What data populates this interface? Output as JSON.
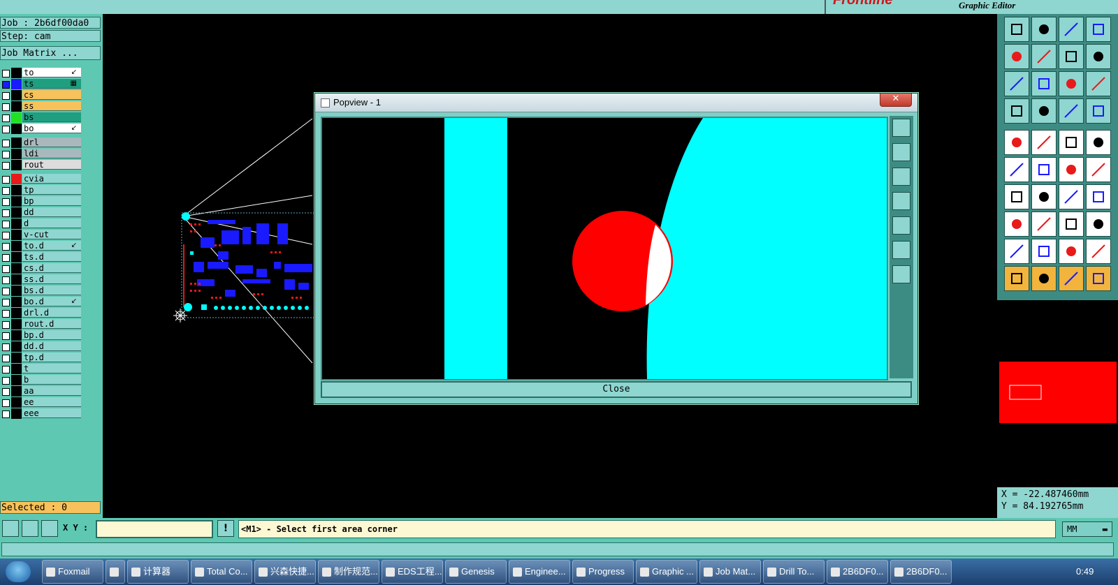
{
  "app": {
    "brand": "Frontline",
    "subtitle": "Graphic Editor"
  },
  "job": {
    "job_line": "Job : 2b6df00da0",
    "step_line": "Step: cam",
    "matrix_button": "Job Matrix ..."
  },
  "layers": [
    {
      "name": "to",
      "color": "#000000",
      "bg": "#ffffff",
      "mark": "↙"
    },
    {
      "name": "ts",
      "color": "#1a1aff",
      "bg": "#1f9e80",
      "mark": "▦",
      "selected": true
    },
    {
      "name": "cs",
      "color": "#000000",
      "bg": "#f7c25b",
      "mark": ""
    },
    {
      "name": "ss",
      "color": "#000000",
      "bg": "#f7c25b",
      "mark": ""
    },
    {
      "name": "bs",
      "color": "#22e022",
      "bg": "#1f9e80",
      "mark": ""
    },
    {
      "name": "bo",
      "color": "#000000",
      "bg": "#ffffff",
      "mark": "↙"
    },
    {
      "name": "drl",
      "color": "#000000",
      "bg": "#a8b8bc",
      "mark": ""
    },
    {
      "name": "ldi",
      "color": "#000000",
      "bg": "#a8b8bc",
      "mark": ""
    },
    {
      "name": "rout",
      "color": "#000000",
      "bg": "#dcdcdc",
      "mark": ""
    },
    {
      "name": "cvia",
      "color": "#e81a1a",
      "bg": "#8fd6d0",
      "mark": ""
    },
    {
      "name": "tp",
      "color": "#000000",
      "bg": "#8fd6d0",
      "mark": ""
    },
    {
      "name": "bp",
      "color": "#000000",
      "bg": "#8fd6d0",
      "mark": ""
    },
    {
      "name": "dd",
      "color": "#000000",
      "bg": "#8fd6d0",
      "mark": ""
    },
    {
      "name": "d",
      "color": "#000000",
      "bg": "#8fd6d0",
      "mark": ""
    },
    {
      "name": "v-cut",
      "color": "#000000",
      "bg": "#8fd6d0",
      "mark": ""
    },
    {
      "name": "to.d",
      "color": "#000000",
      "bg": "#8fd6d0",
      "mark": "↙"
    },
    {
      "name": "ts.d",
      "color": "#000000",
      "bg": "#8fd6d0",
      "mark": ""
    },
    {
      "name": "cs.d",
      "color": "#000000",
      "bg": "#8fd6d0",
      "mark": ""
    },
    {
      "name": "ss.d",
      "color": "#000000",
      "bg": "#8fd6d0",
      "mark": ""
    },
    {
      "name": "bs.d",
      "color": "#000000",
      "bg": "#8fd6d0",
      "mark": ""
    },
    {
      "name": "bo.d",
      "color": "#000000",
      "bg": "#8fd6d0",
      "mark": "↙"
    },
    {
      "name": "drl.d",
      "color": "#000000",
      "bg": "#8fd6d0",
      "mark": ""
    },
    {
      "name": "rout.d",
      "color": "#000000",
      "bg": "#8fd6d0",
      "mark": ""
    },
    {
      "name": "bp.d",
      "color": "#000000",
      "bg": "#8fd6d0",
      "mark": ""
    },
    {
      "name": "dd.d",
      "color": "#000000",
      "bg": "#8fd6d0",
      "mark": ""
    },
    {
      "name": "tp.d",
      "color": "#000000",
      "bg": "#8fd6d0",
      "mark": ""
    },
    {
      "name": "t",
      "color": "#000000",
      "bg": "#8fd6d0",
      "mark": ""
    },
    {
      "name": "b",
      "color": "#000000",
      "bg": "#8fd6d0",
      "mark": ""
    },
    {
      "name": "aa",
      "color": "#000000",
      "bg": "#8fd6d0",
      "mark": ""
    },
    {
      "name": "ee",
      "color": "#000000",
      "bg": "#8fd6d0",
      "mark": ""
    },
    {
      "name": "eee",
      "color": "#000000",
      "bg": "#8fd6d0",
      "mark": ""
    }
  ],
  "selected_text": "Selected : 0",
  "popview": {
    "title": "Popview - 1",
    "close_x": "✕",
    "close_button": "Close"
  },
  "coords": {
    "x_line": "X = -22.487460mm",
    "y_line": "Y = 84.192765mm"
  },
  "command": {
    "xy_label": "X Y :",
    "xy_value": "",
    "exclaim": "!",
    "message": "<M1> - Select first area corner",
    "units": "MM"
  },
  "taskbar": {
    "items": [
      "Foxmail",
      "",
      "计算器",
      "Total Co...",
      "兴森快捷...",
      "制作规范...",
      "EDS工程...",
      "Genesis",
      "Enginee...",
      "Progress",
      "Graphic ...",
      "Job Mat...",
      "Drill To...",
      "2B6DF0...",
      "2B6DF0..."
    ],
    "clock": "0:49"
  },
  "colors": {
    "accent": "#8fd6d0",
    "panel": "#5ec8b2",
    "copper": "#00ffff",
    "highlight": "#ff0000"
  }
}
